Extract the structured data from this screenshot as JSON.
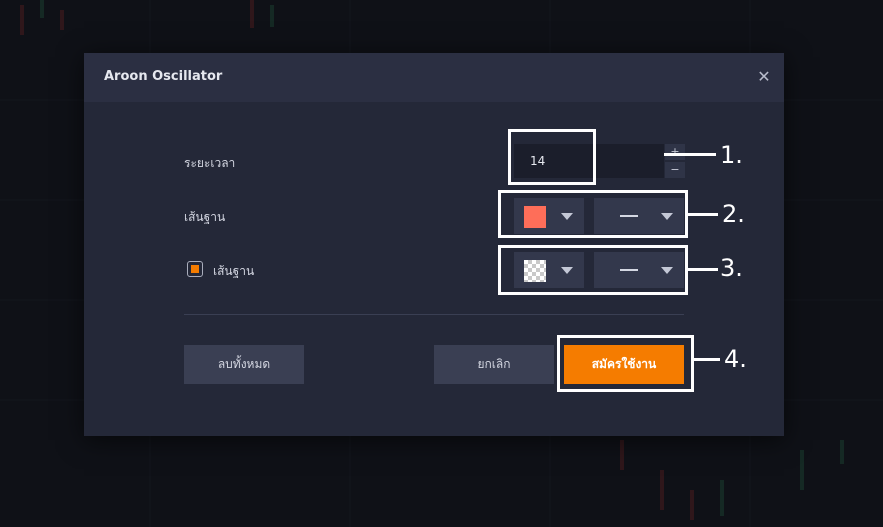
{
  "dialog": {
    "title": "Aroon Oscillator",
    "close_icon": "close-icon"
  },
  "period": {
    "label": "ระยะเวลา",
    "value": "14",
    "increment": "+",
    "decrement": "−"
  },
  "baseline": {
    "label": "เส้นฐาน",
    "color": "#fe6e59",
    "line_style": "solid"
  },
  "baseline_fill": {
    "label": "เส้นฐาน",
    "checked": true,
    "color": "transparent",
    "line_style": "solid"
  },
  "buttons": {
    "clear_all": "ลบทั้งหมด",
    "cancel": "ยกเลิก",
    "apply": "สมัครใช้งาน"
  },
  "callouts": [
    "1.",
    "2.",
    "3.",
    "4."
  ],
  "colors": {
    "accent": "#f57c00",
    "dialog_bg": "#242838",
    "header_bg": "#2b2f42"
  }
}
